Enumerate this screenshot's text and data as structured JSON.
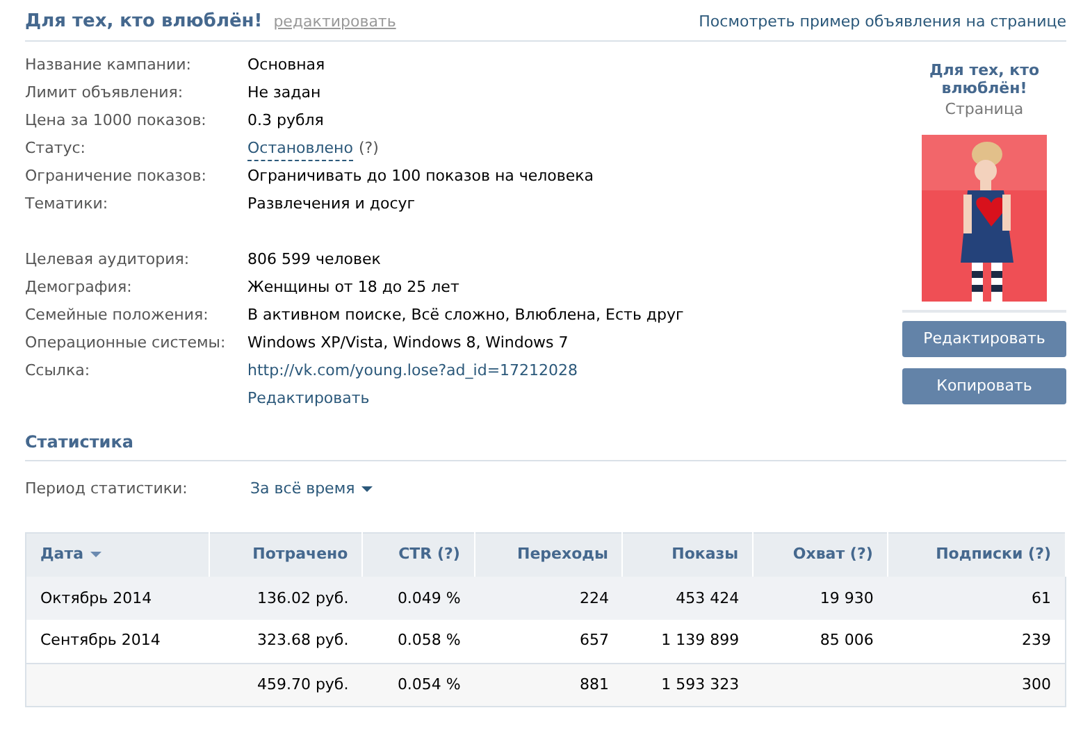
{
  "header": {
    "title": "Для тех, кто влюблён!",
    "edit_link": "редактировать",
    "preview_link": "Посмотреть пример объявления на странице"
  },
  "details": [
    [
      {
        "label": "Название кампании:",
        "value": "Основная",
        "kind": "text"
      },
      {
        "label": "Лимит объявления:",
        "value": "Не задан",
        "kind": "text"
      },
      {
        "label": "Цена за 1000 показов:",
        "value": "0.3 рубля",
        "kind": "text"
      },
      {
        "label": "Статус:",
        "value": "Остановлено",
        "hint": "(?)",
        "kind": "status"
      },
      {
        "label": "Ограничение показов:",
        "value": "Ограничивать до 100 показов на человека",
        "kind": "text"
      },
      {
        "label": "Тематики:",
        "value": "Развлечения и досуг",
        "kind": "text"
      }
    ],
    [
      {
        "label": "Целевая аудитория:",
        "value": "806 599 человек",
        "kind": "text"
      },
      {
        "label": "Демография:",
        "value": "Женщины от 18 до 25 лет",
        "kind": "text"
      },
      {
        "label": "Семейные положения:",
        "value": "В активном поиске, Всё сложно, Влюблена, Есть друг",
        "kind": "text"
      },
      {
        "label": "Операционные системы:",
        "value": "Windows XP/Vista, Windows 8, Windows 7",
        "kind": "text"
      },
      {
        "label": "Ссылка:",
        "value": "http://vk.com/young.lose?ad_id=17212028",
        "kind": "link"
      }
    ]
  ],
  "details_edit_link": "Редактировать",
  "ad_preview": {
    "title": "Для тех, кто влюблён!",
    "subtitle": "Страница"
  },
  "buttons": [
    "Редактировать",
    "Копировать"
  ],
  "statistics": {
    "title": "Статистика",
    "period_label": "Период статистики:",
    "period_value": "За всё время",
    "table": {
      "columns": [
        {
          "label": "Дата",
          "sorted": true
        },
        {
          "label": "Потрачено",
          "sorted": false
        },
        {
          "label": "CTR (?)",
          "sorted": false
        },
        {
          "label": "Переходы",
          "sorted": false
        },
        {
          "label": "Показы",
          "sorted": false
        },
        {
          "label": "Охват (?)",
          "sorted": false
        },
        {
          "label": "Подписки (?)",
          "sorted": false
        }
      ],
      "rows": [
        {
          "highlighted": true,
          "cells": [
            "Октябрь 2014",
            "136.02 руб.",
            "0.049 %",
            "224",
            "453 424",
            "19 930",
            "61"
          ]
        },
        {
          "highlighted": false,
          "cells": [
            "Сентябрь 2014",
            "323.68 руб.",
            "0.058 %",
            "657",
            "1 139 899",
            "85 006",
            "239"
          ]
        },
        {
          "highlighted": false,
          "kind": "total",
          "cells": [
            "",
            "459.70 руб.",
            "0.054 %",
            "881",
            "1 593 323",
            "",
            "300"
          ]
        }
      ]
    }
  }
}
